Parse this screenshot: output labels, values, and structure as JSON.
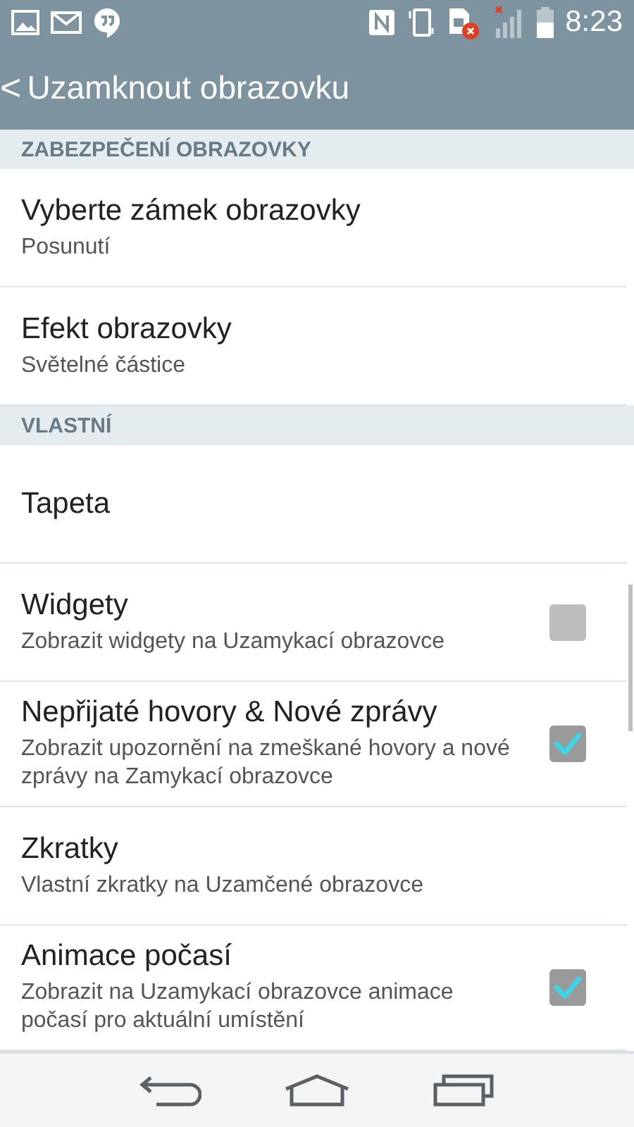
{
  "status_bar": {
    "time": "8:23"
  },
  "header": {
    "back_glyph": "<",
    "title": "Uzamknout obrazovku"
  },
  "settings": [
    {
      "kind": "section",
      "title": "ZABEZPEČENÍ OBRAZOVKY"
    },
    {
      "kind": "item",
      "title": "Vyberte zámek obrazovky",
      "subtitle": "Posunutí"
    },
    {
      "kind": "item",
      "title": "Efekt obrazovky",
      "subtitle": "Světelné částice"
    },
    {
      "kind": "section",
      "title": "VLASTNÍ"
    },
    {
      "kind": "item",
      "title": "Tapeta"
    },
    {
      "kind": "checkbox",
      "title": "Widgety",
      "subtitle": "Zobrazit widgety na Uzamykací obrazovce",
      "checked": false
    },
    {
      "kind": "checkbox",
      "title": "Nepřijaté hovory & Nové zprávy",
      "subtitle": "Zobrazit upozornění na zmeškané hovory a nové zprávy na Zamykací obrazovce",
      "checked": true
    },
    {
      "kind": "item",
      "title": "Zkratky",
      "subtitle": "Vlastní zkratky na Uzamčené obrazovce"
    },
    {
      "kind": "checkbox",
      "title": "Animace počasí",
      "subtitle": "Zobrazit na Uzamykací obrazovce animace počasí pro aktuální umístění",
      "checked": true
    }
  ]
}
